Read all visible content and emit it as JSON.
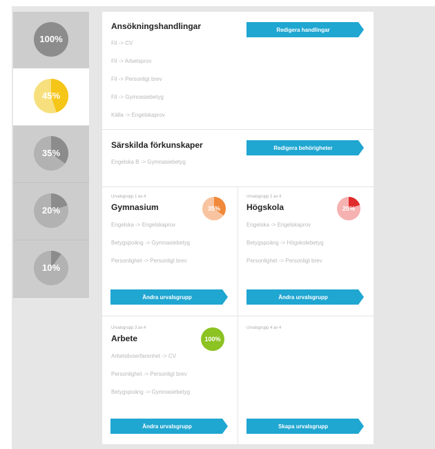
{
  "colors": {
    "accent": "#1fa6d1",
    "sidebar_bg": "#cdcdcd",
    "pie_bg": "#b2b2b2",
    "pie_fill": "#8c8c8c",
    "yellow_bg": "#f7df7e",
    "yellow_fill": "#f5c518",
    "orange_bg": "#f8c4a0",
    "orange_fill": "#f0893a",
    "red_bg": "#f6b1b1",
    "red_fill": "#e02b2b",
    "green": "#8cc221"
  },
  "sidebar": {
    "items": [
      {
        "label": "100%",
        "value": 100
      },
      {
        "label": "45%",
        "value": 45
      },
      {
        "label": "35%",
        "value": 35
      },
      {
        "label": "20%",
        "value": 20
      },
      {
        "label": "10%",
        "value": 10
      }
    ]
  },
  "documents": {
    "title": "Ansökningshandlingar",
    "button": "Redigera handlingar",
    "items": [
      "Fil -> CV",
      "Fil -> Arbetsprov",
      "Fil -> Personligt brev",
      "Fil -> Gymnasiebetyg",
      "Källa -> Engelskaprov"
    ]
  },
  "special": {
    "title": "Särskilda förkunskaper",
    "button": "Redigera behörigheter",
    "items": [
      "Engelska B -> Gymnasiebetyg"
    ]
  },
  "groups": [
    {
      "kicker": "Urvalsgrupp 1 av 4",
      "title": "Gymnasium",
      "percent_label": "35%",
      "value": 35,
      "items": [
        "Engelska -> Engelskaprov",
        "Betygspoäng -> Gymnasiebetyg",
        "Personlighet -> Personligt brev"
      ],
      "button": "Ändra urvalsgrupp"
    },
    {
      "kicker": "Urvalsgrupp 2 av 4",
      "title": "Högskola",
      "percent_label": "20%",
      "value": 20,
      "items": [
        "Engelska -> Engelskaprov",
        "Betygspoäng -> Högskolebetyg",
        "Personlighet -> Personligt brev"
      ],
      "button": "Ändra urvalsgrupp"
    },
    {
      "kicker": "Urvalsgrupp 3 av 4",
      "title": "Arbete",
      "percent_label": "100%",
      "value": 100,
      "items": [
        "Arbetslivserfarenhet -> CV",
        "Personlighet -> Personligt brev",
        "Betygspoäng -> Gymnasiebetyg"
      ],
      "button": "Ändra urvalsgrupp"
    },
    {
      "kicker": "Urvalsgrupp 4 av 4",
      "button": "Skapa urvalsgrupp"
    }
  ]
}
